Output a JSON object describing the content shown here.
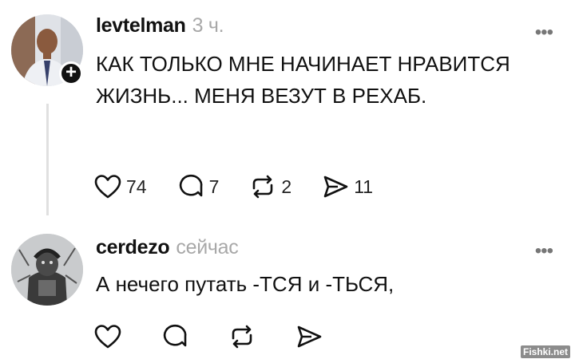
{
  "posts": [
    {
      "username": "levtelman",
      "time": "3 ч.",
      "text": "КАК ТОЛЬКО МНЕ НАЧИНАЕТ НРАВИТСЯ ЖИЗНЬ... МЕНЯ ВЕЗУТ В РЕХАБ.",
      "follow_label": "+",
      "more_label": "•••",
      "likes": "74",
      "replies": "7",
      "reposts": "2",
      "shares": "11"
    },
    {
      "username": "cerdezo",
      "time": "сейчас",
      "text": "А нечего путать -ТСЯ и -ТЬСЯ,",
      "more_label": "•••"
    }
  ],
  "watermark": "Fishki.net",
  "icons": [
    "heart-icon",
    "comment-icon",
    "repost-icon",
    "share-icon",
    "more-icon"
  ],
  "colors": {
    "text": "#111111",
    "muted": "#a8a8a8",
    "thread_line": "#e0e0e0"
  }
}
